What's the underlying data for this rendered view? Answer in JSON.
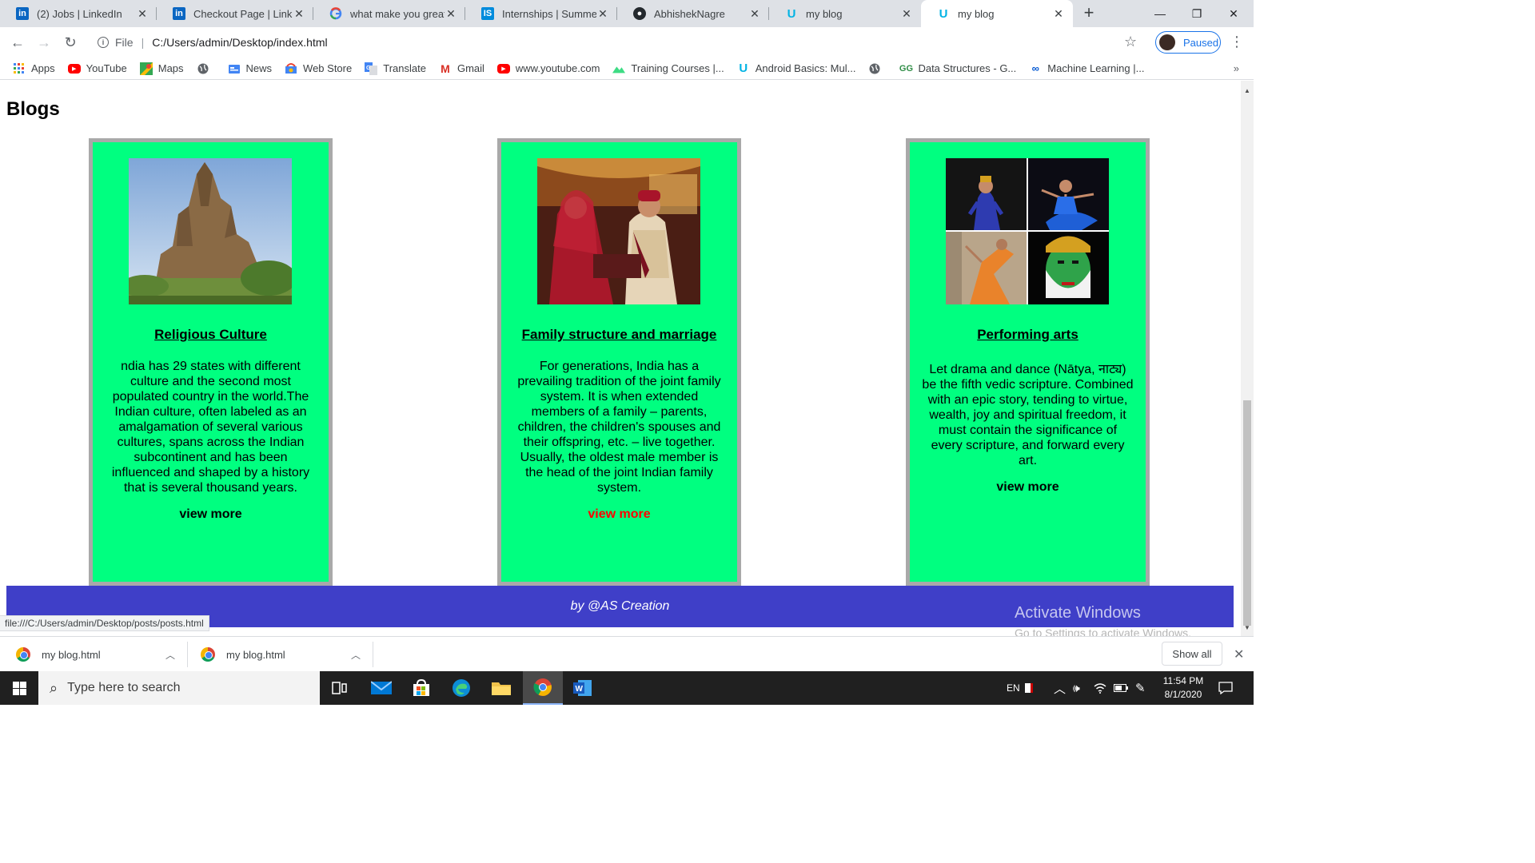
{
  "tabs": [
    {
      "label": "(2) Jobs | LinkedIn",
      "icon": "linkedin-icon"
    },
    {
      "label": "Checkout Page | Linked",
      "icon": "linkedin-icon"
    },
    {
      "label": "what make you great n",
      "icon": "google-icon"
    },
    {
      "label": "Internships | Summer In",
      "icon": "internshala-icon"
    },
    {
      "label": "AbhishekNagre",
      "icon": "github-icon"
    },
    {
      "label": "my blog",
      "icon": "udacity-icon"
    },
    {
      "label": "my blog",
      "icon": "udacity-icon",
      "active": true
    }
  ],
  "toolbar": {
    "scheme": "File",
    "url": "C:/Users/admin/Desktop/index.html",
    "profile_label": "Paused"
  },
  "bookmarks": [
    {
      "label": "Apps",
      "icon": "apps-grid-icon"
    },
    {
      "label": "YouTube",
      "icon": "youtube-icon"
    },
    {
      "label": "Maps",
      "icon": "maps-icon"
    },
    {
      "label": "",
      "icon": "globe-icon"
    },
    {
      "label": "News",
      "icon": "news-icon"
    },
    {
      "label": "Web Store",
      "icon": "webstore-icon"
    },
    {
      "label": "Translate",
      "icon": "translate-icon"
    },
    {
      "label": "Gmail",
      "icon": "gmail-icon"
    },
    {
      "label": "www.youtube.com",
      "icon": "youtube-icon"
    },
    {
      "label": "Training Courses |...",
      "icon": "training-icon"
    },
    {
      "label": "Android Basics: Mul...",
      "icon": "udacity-icon"
    },
    {
      "label": "",
      "icon": "globe-icon"
    },
    {
      "label": "Data Structures - G...",
      "icon": "geeksforgeeks-icon"
    },
    {
      "label": "Machine Learning |...",
      "icon": "coursera-icon"
    }
  ],
  "page": {
    "heading": "Blogs",
    "cards": [
      {
        "title": "Religious Culture",
        "image": "temple",
        "text": "ndia has 29 states with different culture and the second most populated country in the world.The Indian culture, often labeled as an amalgamation of several various cultures, spans across the Indian subcontinent and has been influenced and shaped by a history that is several thousand years.",
        "more": "view more"
      },
      {
        "title": "Family structure and marriage",
        "image": "wedding",
        "text": "For generations, India has a prevailing tradition of the joint family system. It is when extended members of a family – parents, children, the children's spouses and their offspring, etc. – live together. Usually, the oldest male member is the head of the joint Indian family system.",
        "more": "view more"
      },
      {
        "title": "Performing arts",
        "image": "dancers",
        "text": "Let drama and dance (Nātya, नाट्य) be the fifth vedic scripture. Combined with an epic story, tending to virtue, wealth, joy and spiritual freedom, it must contain the significance of every scripture, and forward every art.",
        "more": "view more"
      }
    ],
    "footer": "by @AS Creation",
    "status_url": "file:///C:/Users/admin/Desktop/posts/posts.html"
  },
  "watermark": {
    "title": "Activate Windows",
    "subtitle": "Go to Settings to activate Windows."
  },
  "downloads": {
    "items": [
      {
        "label": "my blog.html"
      },
      {
        "label": "my blog.html"
      }
    ],
    "show_all": "Show all"
  },
  "taskbar": {
    "search_placeholder": "Type here to search",
    "language": "EN",
    "time": "11:54 PM",
    "date": "8/1/2020"
  },
  "colors": {
    "card_bg": "#00ff80",
    "card_border": "#a9a9a9",
    "footer_bg": "#3f3fc8",
    "hover_link": "#ff0000"
  }
}
